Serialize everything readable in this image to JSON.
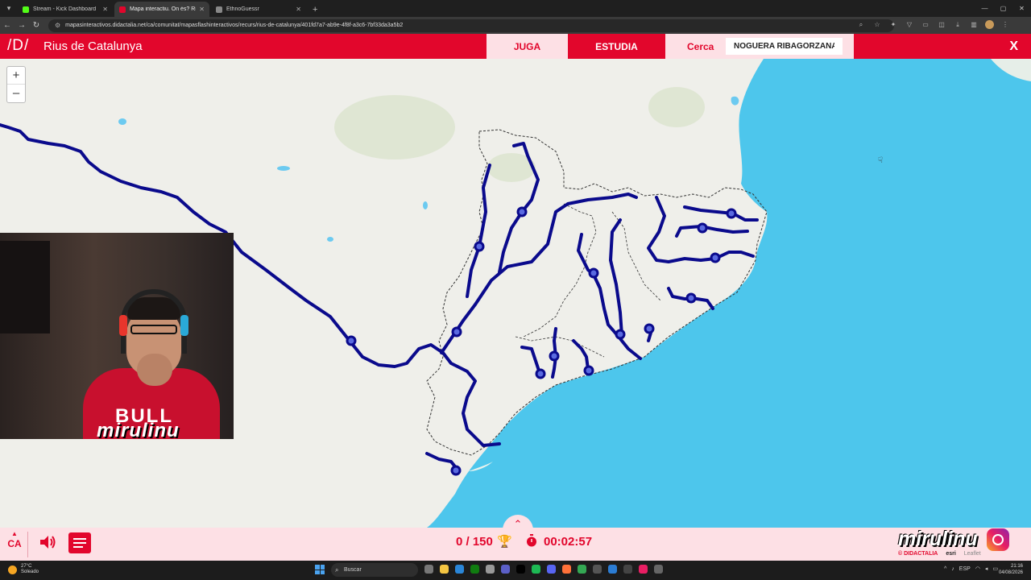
{
  "browser": {
    "tabs": [
      {
        "title": "Stream - Kick Dashboard",
        "active": false,
        "color": "#53fc18"
      },
      {
        "title": "Mapa interactiu. On és? Rius de C",
        "active": true,
        "color": "#e2062c"
      },
      {
        "title": "EthnoGuessr",
        "active": false,
        "color": "#888888"
      }
    ],
    "url": "mapasinteractivos.didactalia.net/ca/comunitat/mapasflashinteractivos/recurs/rius-de-catalunya/401fd7a7-ab9e-4f8f-a3c6-7bf33da3a5b2"
  },
  "app": {
    "logo": "/D/",
    "title": "Rius de Catalunya",
    "tabs": {
      "play": "JUGA",
      "study": "ESTUDIA"
    },
    "search_label": "Cerca",
    "search_value": "NOGUERA RIBAGORZANA",
    "close_label": "X",
    "brand_color": "#e2062c",
    "light_color": "#fde0e5"
  },
  "map": {
    "zoom_in": "+",
    "zoom_out": "–",
    "sea_color": "#4dc6ec",
    "land_color": "#efefea",
    "river_color": "#0a0a8c"
  },
  "webcam": {
    "overlay_text": "mirulinu"
  },
  "footer": {
    "language": "CA",
    "score": "0 / 150",
    "timer": "00:02:57",
    "social_name": "mirulinu",
    "credits": [
      "© DIDACTALIA",
      "esri",
      "Leaflet"
    ]
  },
  "taskbar": {
    "weather_temp": "27°C",
    "weather_desc": "Soleado",
    "search": "Buscar",
    "lang": "ESP",
    "time": "21:16",
    "date": "04/08/2026"
  }
}
